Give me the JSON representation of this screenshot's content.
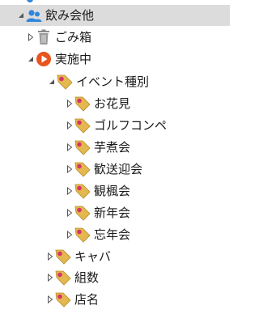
{
  "tree": {
    "root": {
      "label": "飲み会他",
      "icon": "people-icon",
      "expanded": true
    },
    "trash": {
      "label": "ごみ箱",
      "icon": "trash-icon"
    },
    "active": {
      "label": "実施中",
      "icon": "play-circle-icon",
      "expanded": true
    },
    "event_type": {
      "label": "イベント種別",
      "icon": "tag-icon",
      "expanded": true
    },
    "event_children": [
      {
        "label": "お花見"
      },
      {
        "label": "ゴルフコンペ"
      },
      {
        "label": "芋煮会"
      },
      {
        "label": "歓送迎会"
      },
      {
        "label": "観楓会"
      },
      {
        "label": "新年会"
      },
      {
        "label": "忘年会"
      }
    ],
    "other_tags": [
      {
        "label": "キャバ"
      },
      {
        "label": "組数"
      },
      {
        "label": "店名"
      }
    ]
  },
  "colors": {
    "selection": "#dcdcdc",
    "people_icon": "#2e86de",
    "play_icon": "#e8541e",
    "tag_icon": "#e3b84e",
    "tag_dot": "#d6336c",
    "arrow": "#555555"
  }
}
